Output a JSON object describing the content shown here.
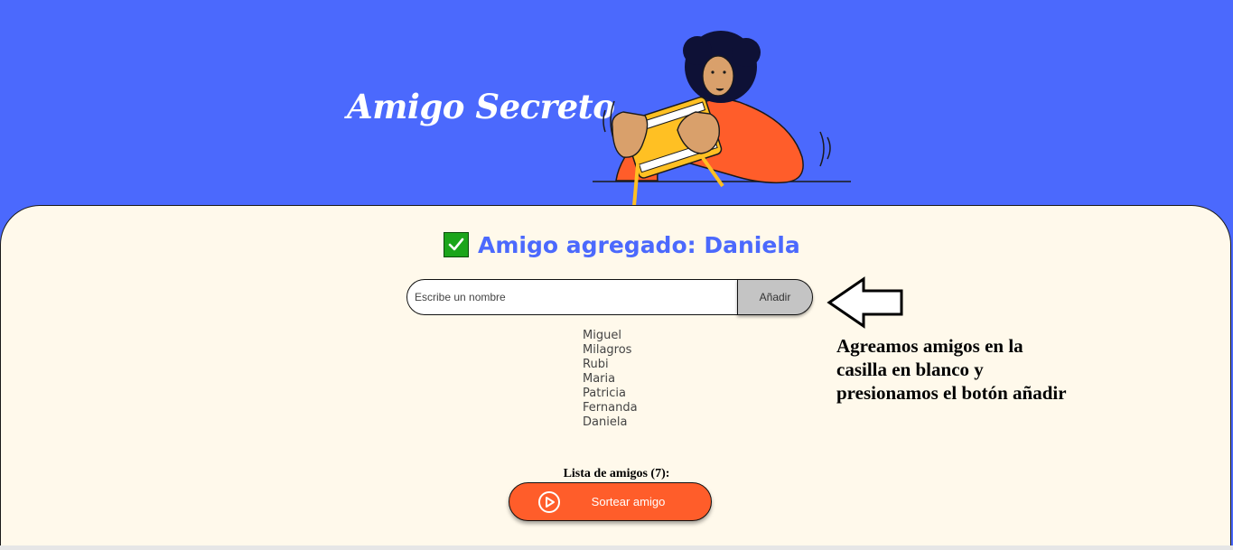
{
  "header": {
    "title": "Amigo Secreto",
    "illustration_icon": "person-holding-gift-illustration"
  },
  "status": {
    "icon": "check-mark-icon",
    "message": "Amigo agregado: Daniela"
  },
  "form": {
    "input_placeholder": "Escribe un nombre",
    "input_value": "",
    "add_label": "Añadir"
  },
  "friends": [
    "Miguel",
    "Milagros",
    "Rubi",
    "Maria",
    "Patricia",
    "Fernanda",
    "Daniela"
  ],
  "annotation": {
    "arrow_icon": "left-arrow-icon",
    "lines": [
      "Agreamos amigos en la",
      "casilla en blanco y",
      "presionamos el botón añadir"
    ]
  },
  "list_count_label": "Lista de amigos (7):",
  "draw_button": {
    "icon": "play-icon",
    "label": "Sortear amigo"
  },
  "colors": {
    "header_bg": "#4b69fd",
    "main_bg": "#fff9eb",
    "accent": "#4b69fd",
    "button_orange": "#ff5d2a",
    "check_green": "#1ba51b"
  }
}
